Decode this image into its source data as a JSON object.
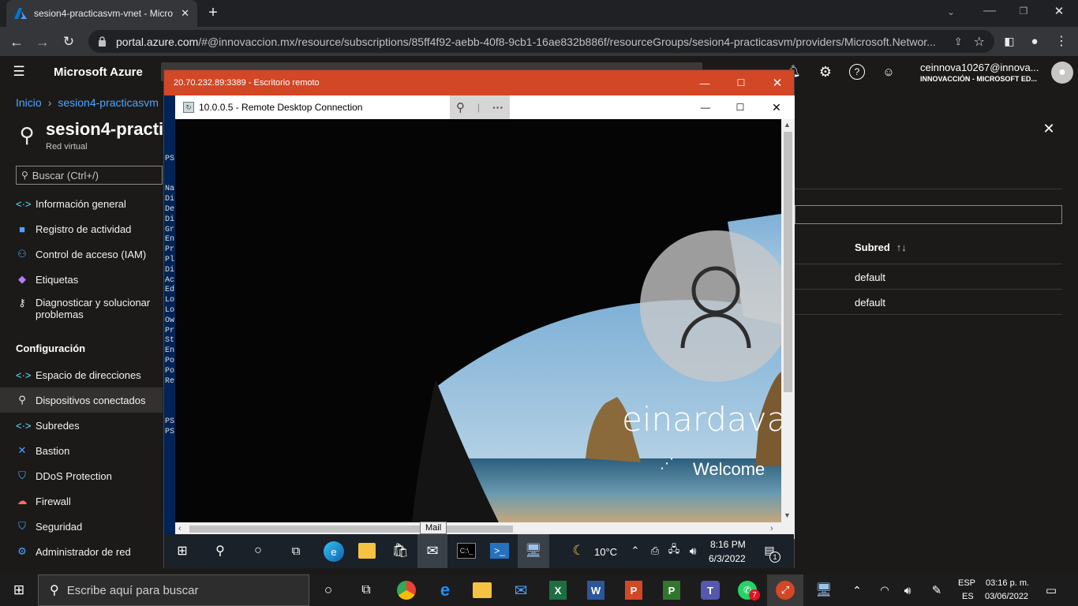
{
  "browser": {
    "tab_title": "sesion4-practicasvm-vnet - Micro",
    "url_host": "portal.azure.com",
    "url_path": "/#@innovaccion.mx/resource/subscriptions/85ff4f92-aebb-40f8-9cb1-16ae832b886f/resourceGroups/sesion4-practicasvm/providers/Microsoft.Networ..."
  },
  "portal": {
    "brand": "Microsoft Azure",
    "account_name": "ceinnova10267@innova...",
    "account_org": "INNOVACCIÓN - MICROSOFT ED...",
    "breadcrumb": {
      "home": "Inicio",
      "current": "sesion4-practicasvm"
    },
    "resource_title": "sesion4-practi",
    "resource_subtitle": "Red virtual",
    "search_placeholder": "Buscar (Ctrl+/)",
    "nav_general": [
      {
        "label": "Información general",
        "icon": "<·>",
        "color": "#50e6ff"
      },
      {
        "label": "Registro de actividad",
        "icon": "■",
        "color": "#4da3ff"
      },
      {
        "label": "Control de acceso (IAM)",
        "icon": "⚇",
        "color": "#4da3ff"
      },
      {
        "label": "Etiquetas",
        "icon": "◆",
        "color": "#b57bff"
      },
      {
        "label": "Diagnosticar y solucionar problemas",
        "icon": "⚷",
        "color": "#e8e8e8"
      }
    ],
    "config_heading": "Configuración",
    "nav_config": [
      {
        "label": "Espacio de direcciones",
        "icon": "<·>",
        "color": "#50e6ff"
      },
      {
        "label": "Dispositivos conectados",
        "icon": "⚲",
        "color": "#e8e8e8"
      },
      {
        "label": "Subredes",
        "icon": "<·>",
        "color": "#50e6ff"
      },
      {
        "label": "Bastion",
        "icon": "✕",
        "color": "#4da3ff"
      },
      {
        "label": "DDoS Protection",
        "icon": "⛉",
        "color": "#4da3ff"
      },
      {
        "label": "Firewall",
        "icon": "☁",
        "color": "#ff6b6b"
      },
      {
        "label": "Seguridad",
        "icon": "⛉",
        "color": "#4da3ff"
      },
      {
        "label": "Administrador de red",
        "icon": "⚙",
        "color": "#4da3ff"
      }
    ],
    "table": {
      "col_header": "Subred",
      "sort_icon": "↑↓",
      "rows": [
        "default",
        "default"
      ]
    }
  },
  "rdp_outer": {
    "title": "20.70.232.89:3389 - Escritorio remoto"
  },
  "rdp_inner": {
    "title": "10.0.0.5 - Remote Desktop Connection",
    "ps_lines": [
      "PS",
      "",
      "",
      "Na",
      "Di",
      "De",
      "Di",
      "Gr",
      "En",
      "Pr",
      "Pl",
      "Di",
      "Ac",
      "Ed",
      "Lo",
      "Lo",
      "Ow",
      "Pr",
      "St",
      "En",
      "Po",
      "Po",
      "Re",
      "",
      "",
      "",
      "PS",
      "PS"
    ],
    "username": "einardavalo",
    "welcome": "Welcome",
    "tooltip": "Mail"
  },
  "remote_taskbar": {
    "temperature": "10°C",
    "time": "8:16 PM",
    "date": "6/3/2022",
    "notifications": "1"
  },
  "host_taskbar": {
    "search_placeholder": "Escribe aquí para buscar",
    "lang_top": "ESP",
    "lang_bottom": "ES",
    "time": "03:16 p. m.",
    "date": "03/06/2022",
    "whatsapp_badge": "7"
  }
}
